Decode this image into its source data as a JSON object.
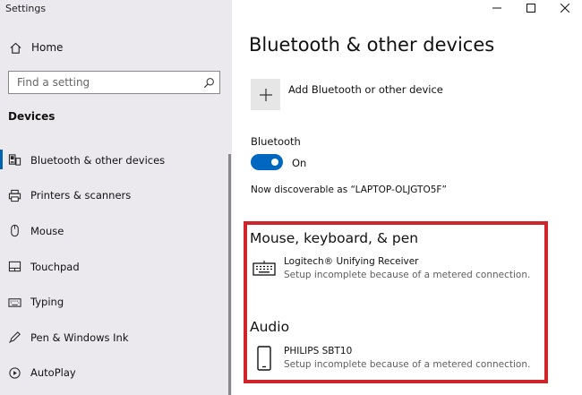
{
  "window": {
    "title": "Settings"
  },
  "sidebar": {
    "home_label": "Home",
    "search": {
      "placeholder": "Find a setting"
    },
    "section_title": "Devices",
    "items": [
      {
        "label": "Bluetooth & other devices",
        "icon": "bluetooth-devices-icon",
        "active": true
      },
      {
        "label": "Printers & scanners",
        "icon": "printer-icon"
      },
      {
        "label": "Mouse",
        "icon": "mouse-icon"
      },
      {
        "label": "Touchpad",
        "icon": "touchpad-icon"
      },
      {
        "label": "Typing",
        "icon": "keyboard-icon"
      },
      {
        "label": "Pen & Windows Ink",
        "icon": "pen-icon"
      },
      {
        "label": "AutoPlay",
        "icon": "autoplay-icon"
      }
    ]
  },
  "main": {
    "title": "Bluetooth & other devices",
    "add_device_label": "Add Bluetooth or other device",
    "bluetooth": {
      "label": "Bluetooth",
      "state": "On",
      "on": true
    },
    "discoverable_text": "Now discoverable as “LAPTOP-OLJGTO5F”",
    "groups": [
      {
        "title": "Mouse, keyboard, & pen",
        "devices": [
          {
            "name": "Logitech® Unifying Receiver",
            "status": "Setup incomplete because of a metered connection.",
            "icon": "keyboard-icon"
          }
        ]
      },
      {
        "title": "Audio",
        "devices": [
          {
            "name": "PHILIPS SBT10",
            "status": "Setup incomplete because of a metered connection.",
            "icon": "phone-icon"
          }
        ]
      }
    ]
  },
  "colors": {
    "accent": "#0067c0",
    "highlight": "#d0242b",
    "sidebar_bg": "#ece9ee"
  }
}
